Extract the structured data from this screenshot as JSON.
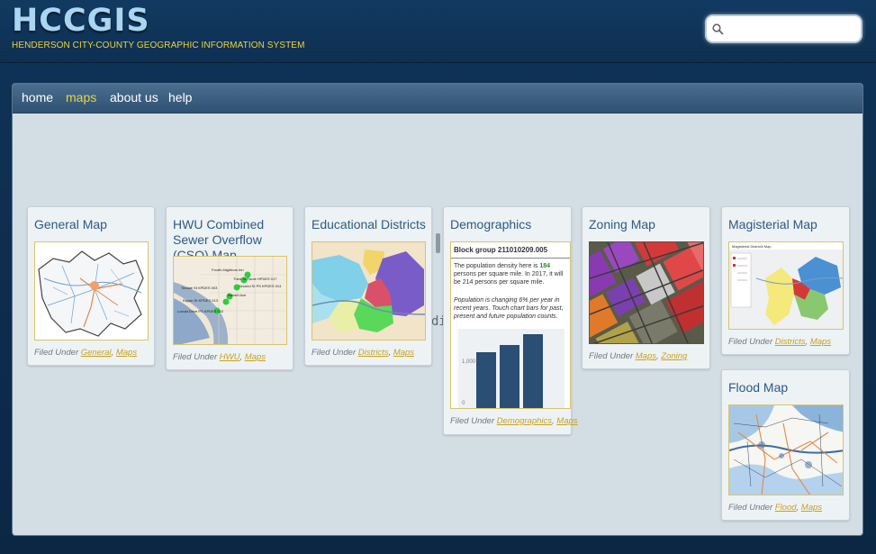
{
  "header": {
    "logo": "HCCGIS",
    "tagline": "HENDERSON CITY-COUNTY GEOGRAPHIC INFORMATION SYSTEM",
    "search_placeholder": ""
  },
  "nav": {
    "items": [
      {
        "label": "home"
      },
      {
        "label": "maps",
        "active": true
      },
      {
        "label": "about us"
      },
      {
        "label": "help"
      }
    ],
    "active_color": "#e8d640"
  },
  "ghost_text": "di",
  "cards": [
    {
      "title": "General Map",
      "filed_prefix": "Filed Under",
      "tags": [
        "General",
        "Maps"
      ]
    },
    {
      "title": "HWU Combined Sewer Overflow (CSO) Map",
      "filed_prefix": "Filed Under",
      "tags": [
        "HWU",
        "Maps"
      ]
    },
    {
      "title": "Educational Districts",
      "filed_prefix": "Filed Under",
      "tags": [
        "Districts",
        "Maps"
      ]
    },
    {
      "title": "Demographics",
      "filed_prefix": "Filed Under",
      "tags": [
        "Demographics",
        "Maps"
      ],
      "popup": {
        "heading": "Block group 211010209.005",
        "text_pre": "The population density here is ",
        "density": "184",
        "text_post": " persons per square mile.  In 2017, it will be 214 persons per square mile.",
        "note": "Population is changing 6% per year in recent years. Touch chart bars for past, present and future population counts.",
        "chart_tick": "1,000",
        "chart_zero": "0"
      }
    },
    {
      "title": "Zoning Map",
      "filed_prefix": "Filed Under",
      "tags": [
        "Maps",
        "Zoning"
      ]
    },
    {
      "title": "Magisterial Map",
      "filed_prefix": "Filed Under",
      "tags": [
        "Districts",
        "Maps"
      ],
      "thumb_title": "Magisterial Districts Map"
    },
    {
      "title": "Flood Map",
      "filed_prefix": "Filed Under",
      "tags": [
        "Flood",
        "Maps"
      ]
    }
  ],
  "cso_labels": [
    "Fourth-Nighbors Inn",
    "Third St Route HPDES 017",
    "Second St PS KPDES 014",
    "Tindale St KPDES 003",
    "Bandel Ave",
    "Rayan St KPDES 013",
    "Locust Drive PS KPDES 002"
  ],
  "colors": {
    "title": "#2c5a85",
    "tag_link": "#c8a21e",
    "accent": "#e8d640",
    "logo": "#a9d6f2"
  }
}
